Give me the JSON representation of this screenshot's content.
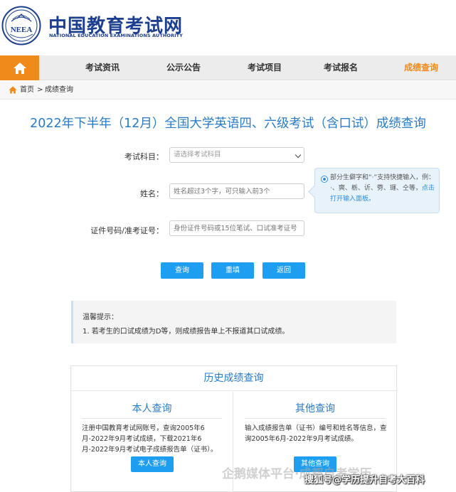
{
  "header": {
    "logo_cn": "中国教育考试网",
    "logo_en": "NATIONAL EDUCATION EXAMINATIONS AUTHORITY",
    "emblem_text": "NEEA"
  },
  "nav": {
    "home_icon": "home-icon",
    "items": [
      {
        "label": "考试资讯"
      },
      {
        "label": "公示公告"
      },
      {
        "label": "考试项目"
      },
      {
        "label": "考试报名"
      },
      {
        "label": "成绩查询"
      }
    ],
    "active_color": "#f08a1a"
  },
  "breadcrumb": {
    "home": "首页",
    "separator": ">",
    "current": "成绩查询"
  },
  "page_title": "2022年下半年（12月）全国大学英语四、六级考试（含口试）成绩查询",
  "form": {
    "subject_label": "考试科目：",
    "subject_value": "请选择考试科目",
    "name_label": "姓名：",
    "name_placeholder": "姓名超过3个字，可只输入前3个",
    "id_label": "证件号码/准考证号：",
    "id_placeholder": "身份证件号码或15位笔试、口试准考证号"
  },
  "tip": {
    "line1": "部分生僻字和“·”支持快捷输入，例：·、奭、栃、䜣、䓖、璭、仝等，",
    "link": "点击打开输入面板。"
  },
  "buttons": {
    "query": "查询",
    "reset": "重填",
    "back": "返回"
  },
  "notice": {
    "title": "温馨提示：",
    "item1": "1. 若考生的口试成绩为D等，则成绩报告单上不报道其口试成绩。"
  },
  "history": {
    "title": "历史成绩查询",
    "self": {
      "title": "本人查询",
      "text": "注册中国教育考试网账号，查询2005年6月-2022年9月考试成绩，下载2021年6月-2022年9月考试电子成绩报告单（证书）。",
      "button": "本人查询"
    },
    "other": {
      "title": "其他查询",
      "text": "输入成绩报告单（证书）编号和姓名等信息，查询2005年6月-2022年9月考试成绩。",
      "button": "其他查询"
    }
  },
  "watermark": {
    "faded": "企鹅媒体平台·成都自考学历",
    "main": "搜狐号@学历提升自考大百科"
  },
  "colors": {
    "brand_blue": "#1d3f8f",
    "title_blue": "#2a7bc3",
    "button_blue": "#1e9ef0",
    "accent_orange": "#f08a1a"
  }
}
